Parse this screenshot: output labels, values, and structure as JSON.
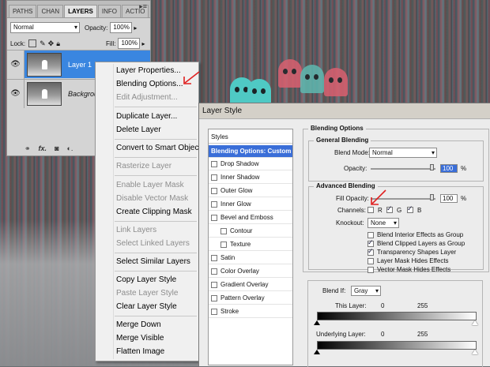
{
  "colors": {
    "accent": "#3a6ed8",
    "arrow": "#e02020",
    "ghost_teal": "#4fc9c4",
    "ghost_red": "#d96070"
  },
  "layers_panel": {
    "tabs": [
      "PATHS",
      "CHAN",
      "LAYERS",
      "INFO",
      "ACTIO"
    ],
    "active_tab": "LAYERS",
    "blend_mode": "Normal",
    "opacity_label": "Opacity:",
    "opacity_value": "100%",
    "lock_label": "Lock:",
    "fill_label": "Fill:",
    "fill_value": "100%",
    "layers": [
      {
        "name": "Layer 1",
        "selected": true
      },
      {
        "name": "Backgroun",
        "selected": false
      }
    ],
    "footer_icons": [
      "link-icon",
      "fx-icon",
      "mask-icon",
      "adjustment-icon"
    ]
  },
  "context_menu": {
    "items": [
      {
        "label": "Layer Properties...",
        "enabled": true
      },
      {
        "label": "Blending Options...",
        "enabled": true
      },
      {
        "label": "Edit Adjustment...",
        "enabled": false
      },
      {
        "label": "Duplicate Layer...",
        "enabled": true
      },
      {
        "label": "Delete Layer",
        "enabled": true
      },
      {
        "label": "Convert to Smart Object",
        "enabled": true
      },
      {
        "label": "Rasterize Layer",
        "enabled": false
      },
      {
        "label": "Enable Layer Mask",
        "enabled": false
      },
      {
        "label": "Disable Vector Mask",
        "enabled": false
      },
      {
        "label": "Create Clipping Mask",
        "enabled": true
      },
      {
        "label": "Link Layers",
        "enabled": false
      },
      {
        "label": "Select Linked Layers",
        "enabled": false
      },
      {
        "label": "Select Similar Layers",
        "enabled": true
      },
      {
        "label": "Copy Layer Style",
        "enabled": true
      },
      {
        "label": "Paste Layer Style",
        "enabled": false
      },
      {
        "label": "Clear Layer Style",
        "enabled": true
      },
      {
        "label": "Merge Down",
        "enabled": true
      },
      {
        "label": "Merge Visible",
        "enabled": true
      },
      {
        "label": "Flatten Image",
        "enabled": true
      }
    ]
  },
  "layer_style": {
    "title": "Layer Style",
    "styles_header": "Styles",
    "styles": [
      {
        "label": "Blending Options: Custom",
        "selected": true,
        "checkbox": false
      },
      {
        "label": "Drop Shadow",
        "checkbox": true
      },
      {
        "label": "Inner Shadow",
        "checkbox": true
      },
      {
        "label": "Outer Glow",
        "checkbox": true
      },
      {
        "label": "Inner Glow",
        "checkbox": true
      },
      {
        "label": "Bevel and Emboss",
        "checkbox": true
      },
      {
        "label": "Contour",
        "checkbox": true,
        "inset": true
      },
      {
        "label": "Texture",
        "checkbox": true,
        "inset": true
      },
      {
        "label": "Satin",
        "checkbox": true
      },
      {
        "label": "Color Overlay",
        "checkbox": true
      },
      {
        "label": "Gradient Overlay",
        "checkbox": true
      },
      {
        "label": "Pattern Overlay",
        "checkbox": true
      },
      {
        "label": "Stroke",
        "checkbox": true
      }
    ],
    "blending_options_title": "Blending Options",
    "general_blending_title": "General Blending",
    "blend_mode_label": "Blend Mode:",
    "blend_mode_value": "Normal",
    "opacity_label": "Opacity:",
    "opacity_value": "100",
    "percent": "%",
    "advanced_blending_title": "Advanced Blending",
    "fill_opacity_label": "Fill Opacity:",
    "fill_opacity_value": "100",
    "channels_label": "Channels:",
    "channels": [
      {
        "label": "R",
        "checked": false
      },
      {
        "label": "G",
        "checked": true
      },
      {
        "label": "B",
        "checked": true
      }
    ],
    "knockout_label": "Knockout:",
    "knockout_value": "None",
    "advanced_checks": [
      {
        "label": "Blend Interior Effects as Group",
        "checked": false
      },
      {
        "label": "Blend Clipped Layers as Group",
        "checked": true
      },
      {
        "label": "Transparency Shapes Layer",
        "checked": true
      },
      {
        "label": "Layer Mask Hides Effects",
        "checked": false
      },
      {
        "label": "Vector Mask Hides Effects",
        "checked": false
      }
    ],
    "blend_if_label": "Blend If:",
    "blend_if_value": "Gray",
    "this_layer_label": "This Layer:",
    "this_layer_min": "0",
    "this_layer_max": "255",
    "underlying_label": "Underlying Layer:",
    "underlying_min": "0",
    "underlying_max": "255"
  }
}
